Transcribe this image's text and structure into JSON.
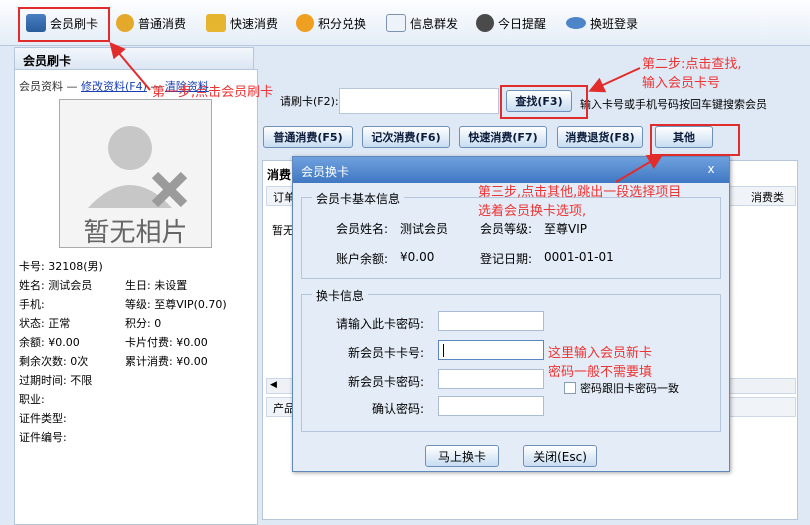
{
  "toolbar": {
    "items": [
      {
        "label": "会员刷卡",
        "icon": "card-swipe-icon"
      },
      {
        "label": "普通消费",
        "icon": "money-bag-icon"
      },
      {
        "label": "快速消费",
        "icon": "lightning-icon"
      },
      {
        "label": "积分兑换",
        "icon": "exchange-icon"
      },
      {
        "label": "信息群发",
        "icon": "envelope-icon"
      },
      {
        "label": "今日提醒",
        "icon": "clock-icon"
      },
      {
        "label": "换班登录",
        "icon": "key-icon"
      }
    ]
  },
  "left": {
    "panel_title": "会员刷卡",
    "legend_main": "会员资料",
    "legend_edit": "修改资料(F4)",
    "legend_clear": "清除资料",
    "photo_text": "暂无相片",
    "card_no": "卡号: 32108(男)",
    "name": "姓名: 测试会员",
    "birthday": "生日: 未设置",
    "phone": "手机:",
    "level": "等级: 至尊VIP(0.70)",
    "status": "状态: 正常",
    "points": "积分: 0",
    "balance": "余额: ¥0.00",
    "card_fee": "卡片付费: ¥0.00",
    "remain_times": "剩余次数: 0次",
    "total_spend": "累计消费: ¥0.00",
    "expire": "过期时间: 不限",
    "job": "职业:",
    "id_type": "证件类型:",
    "id_no": "证件编号:"
  },
  "search": {
    "card_label": "请刷卡(F2):",
    "card_value": "",
    "find_button": "查找(F3)",
    "hint": "输入卡号或手机号码按回车键搜索会员"
  },
  "actions": {
    "normal": "普通消费(F5)",
    "count": "记次消费(F6)",
    "quick": "快速消费(F7)",
    "refund": "消费退货(F8)",
    "other": "其他"
  },
  "tabs": {
    "tab1": "消费",
    "col_order": "订单",
    "col_type": "消费类",
    "empty": "暂无",
    "col_product": "产品"
  },
  "modal": {
    "title": "会员换卡",
    "close": "x",
    "basic_legend": "会员卡基本信息",
    "name_label": "会员姓名:",
    "name_value": "测试会员",
    "level_label": "会员等级:",
    "level_value": "至尊VIP",
    "balance_label": "账户余额:",
    "balance_value": "¥0.00",
    "regdate_label": "登记日期:",
    "regdate_value": "0001-01-01",
    "change_legend": "换卡信息",
    "pwd_label": "请输入此卡密码:",
    "newcard_label": "新会员卡卡号:",
    "newpwd_label": "新会员卡密码:",
    "confirm_label": "确认密码:",
    "same_pwd": "密码跟旧卡密码一致",
    "submit": "马上换卡",
    "cancel": "关闭(Esc)"
  },
  "annotations": {
    "step1": "第一步,点击会员刷卡",
    "step2_line1": "第二步:点击查找,",
    "step2_line2": "输入会员卡号",
    "step3_line1": "第三步,点击其他,跳出一段选择项目",
    "step3_line2": "选着会员换卡选项,",
    "note_line1": "这里输入会员新卡",
    "note_line2": "密码一般不需要填"
  },
  "colors": {
    "annotation": "#e22b2b",
    "title_bar": "#3f77c2"
  }
}
